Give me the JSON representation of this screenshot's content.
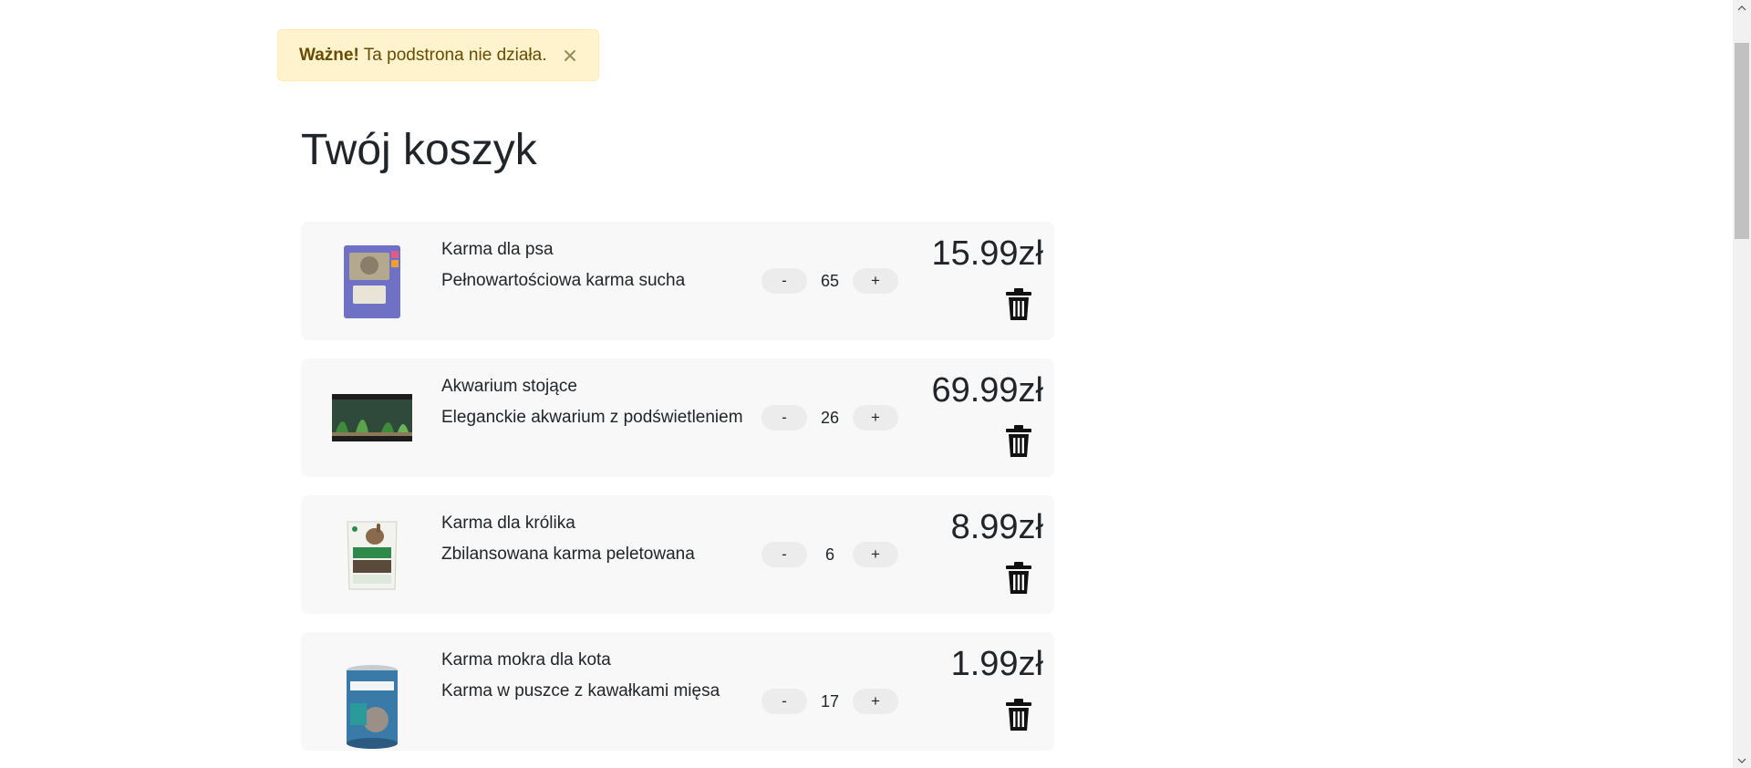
{
  "alert": {
    "strong": "Ważne!",
    "message": "Ta podstrona nie działa.",
    "close_icon": "close-icon",
    "bg_color": "#fff3cd",
    "text_color": "#664d03"
  },
  "page_title": "Twój koszyk",
  "cart": {
    "items": [
      {
        "name": "Karma dla psa",
        "description": "Pełnowartościowa karma sucha",
        "quantity": "65",
        "price": "15.99zł",
        "image_icon": "dry-food-box-image",
        "minus_label": "-",
        "plus_label": "+"
      },
      {
        "name": "Akwarium stojące",
        "description": "Eleganckie akwarium z podświetleniem",
        "quantity": "26",
        "price": "69.99zł",
        "image_icon": "aquarium-image",
        "minus_label": "-",
        "plus_label": "+"
      },
      {
        "name": "Karma dla królika",
        "description": "Zbilansowana karma peletowana",
        "quantity": "6",
        "price": "8.99zł",
        "image_icon": "rabbit-food-bag-image",
        "minus_label": "-",
        "plus_label": "+"
      },
      {
        "name": "Karma mokra dla kota",
        "description": "Karma w puszce z kawałkami mięsa",
        "quantity": "17",
        "price": "1.99zł",
        "image_icon": "cat-food-can-image",
        "minus_label": "-",
        "plus_label": "+"
      }
    ],
    "delete_icon": "trash-icon"
  }
}
